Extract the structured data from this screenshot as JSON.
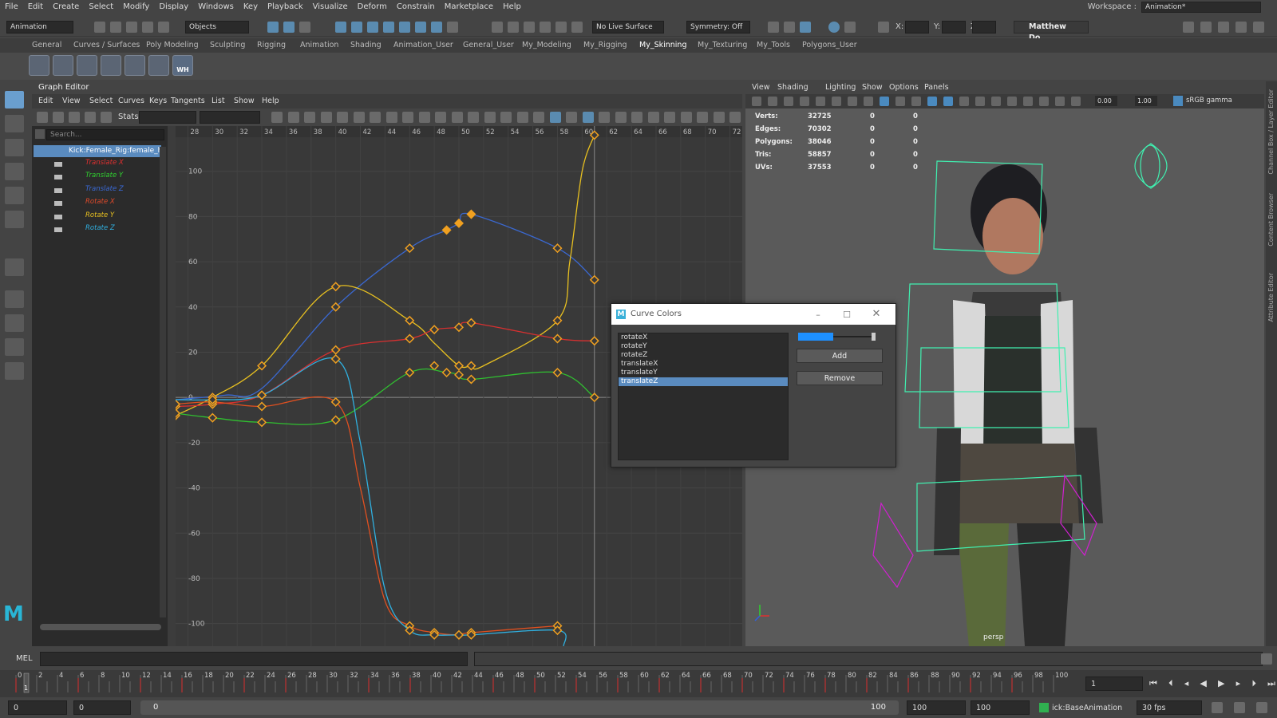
{
  "menubar": {
    "items": [
      "File",
      "Edit",
      "Create",
      "Select",
      "Modify",
      "Display",
      "Windows",
      "Key",
      "Playback",
      "Visualize",
      "Deform",
      "Constrain",
      "Marketplace",
      "Help"
    ],
    "workspace_label": "Workspace :",
    "workspace_value": "Animation*"
  },
  "statusline": {
    "mode": "Animation",
    "selection_mode": "Objects",
    "live_surface": "No Live Surface",
    "symmetry": "Symmetry: Off",
    "x_label": "X:",
    "y_label": "Y:",
    "z_label": "Z:",
    "user": "Matthew Do..."
  },
  "shelf": {
    "tabs": [
      "General",
      "Curves / Surfaces",
      "Poly Modeling",
      "Sculpting",
      "Rigging",
      "Animation",
      "Shading",
      "Animation_User",
      "General_User",
      "My_Modeling",
      "My_Rigging",
      "My_Skinning",
      "My_Texturing",
      "My_Tools",
      "Polygons_User"
    ],
    "active": "My_Skinning",
    "wh_label": "WH"
  },
  "graph_editor": {
    "title": "Graph Editor",
    "menu": [
      "Edit",
      "View",
      "Select",
      "Curves",
      "Keys",
      "Tangents",
      "List",
      "Show",
      "Help"
    ],
    "stats_label": "Stats",
    "search_placeholder": "Search...",
    "root": "Kick:Female_Rig:female_hip",
    "channels": [
      {
        "name": "Translate X",
        "color": "#e03030"
      },
      {
        "name": "Translate Y",
        "color": "#30d030"
      },
      {
        "name": "Translate Z",
        "color": "#3a6ad8"
      },
      {
        "name": "Rotate X",
        "color": "#e04a2a"
      },
      {
        "name": "Rotate Y",
        "color": "#e8c020"
      },
      {
        "name": "Rotate Z",
        "color": "#30b0e0"
      }
    ],
    "x_ticks": [
      "28",
      "30",
      "32",
      "34",
      "36",
      "38",
      "40",
      "42",
      "44",
      "46",
      "48",
      "50",
      "52",
      "54",
      "56",
      "58",
      "60",
      "62",
      "64",
      "66",
      "68",
      "70",
      "72"
    ],
    "y_ticks": [
      "100",
      "80",
      "60",
      "40",
      "20",
      "0",
      "-20",
      "-40",
      "-60",
      "-80",
      "-100"
    ],
    "current_frame_line": 61
  },
  "chart_data": {
    "type": "line",
    "xlim": [
      27,
      73
    ],
    "ylim": [
      -107,
      120
    ],
    "grid": true,
    "series": [
      {
        "name": "Translate Z",
        "color": "#3a68d0",
        "x": [
          27,
          31,
          34,
          40,
          46,
          49,
          50,
          51,
          58,
          61
        ],
        "y": [
          -1,
          1,
          4,
          40,
          66,
          74,
          77,
          81,
          66,
          52
        ],
        "keys": [
          [
            46,
            66
          ],
          [
            49,
            74
          ],
          [
            50,
            77
          ],
          [
            51,
            81
          ],
          [
            58,
            66
          ],
          [
            61,
            52
          ]
        ]
      },
      {
        "name": "Rotate Y",
        "color": "#e8c020",
        "x": [
          27,
          30,
          34,
          40,
          46,
          48,
          50,
          51,
          52,
          58,
          59,
          60,
          61
        ],
        "y": [
          -8,
          0,
          14,
          49,
          34,
          24,
          14,
          14,
          14,
          34,
          60,
          100,
          116
        ],
        "keys": [
          [
            27,
            -8
          ],
          [
            30,
            0
          ],
          [
            34,
            14
          ],
          [
            40,
            49
          ],
          [
            40,
            40
          ],
          [
            46,
            34
          ],
          [
            48,
            14
          ],
          [
            50,
            14
          ],
          [
            51,
            14
          ],
          [
            58,
            34
          ],
          [
            61,
            116
          ]
        ]
      },
      {
        "name": "Translate X",
        "color": "#d83030",
        "x": [
          27,
          30,
          34,
          40,
          46,
          48,
          50,
          51,
          58,
          61
        ],
        "y": [
          -4,
          -3,
          1,
          21,
          26,
          30,
          31,
          33,
          26,
          25
        ],
        "keys": [
          [
            27,
            -4
          ],
          [
            30,
            -3
          ],
          [
            34,
            1
          ],
          [
            40,
            21
          ],
          [
            46,
            26
          ],
          [
            48,
            30
          ],
          [
            50,
            31
          ],
          [
            51,
            33
          ],
          [
            58,
            26
          ],
          [
            61,
            25
          ]
        ]
      },
      {
        "name": "Translate Y",
        "color": "#30c030",
        "x": [
          27,
          30,
          34,
          40,
          46,
          49,
          50,
          51,
          58,
          61
        ],
        "y": [
          -7,
          -9,
          -11,
          -10,
          11,
          11,
          10,
          8,
          11,
          0
        ],
        "keys": [
          [
            27,
            -7
          ],
          [
            30,
            -9
          ],
          [
            34,
            -11
          ],
          [
            40,
            -10
          ],
          [
            46,
            11
          ],
          [
            49,
            11
          ],
          [
            50,
            10
          ],
          [
            51,
            8
          ],
          [
            58,
            11
          ],
          [
            61,
            0
          ]
        ]
      },
      {
        "name": "Rotate X",
        "color": "#e05020",
        "x": [
          27,
          30,
          34,
          40,
          42,
          44,
          46,
          48,
          50,
          51,
          58
        ],
        "y": [
          -3,
          -2,
          -4,
          -2,
          -40,
          -90,
          -101,
          -104,
          -105,
          -104,
          -101
        ],
        "keys": [
          [
            27,
            -3
          ],
          [
            30,
            -2
          ],
          [
            34,
            -4
          ],
          [
            40,
            -2
          ],
          [
            46,
            -101
          ],
          [
            48,
            -104
          ],
          [
            50,
            -105
          ],
          [
            51,
            -104
          ],
          [
            58,
            -101
          ]
        ]
      },
      {
        "name": "Rotate Z",
        "color": "#30b0e0",
        "x": [
          27,
          30,
          34,
          40,
          42,
          44,
          46,
          48,
          50,
          51,
          58,
          58.5
        ],
        "y": [
          -1,
          -1,
          1,
          17,
          -20,
          -85,
          -103,
          -105,
          -105,
          -105,
          -103,
          -110
        ],
        "keys": [
          [
            30,
            -1
          ],
          [
            34,
            1
          ],
          [
            40,
            17
          ],
          [
            46,
            -103
          ],
          [
            48,
            -105
          ],
          [
            50,
            -105
          ],
          [
            51,
            -105
          ],
          [
            58,
            -103
          ]
        ]
      }
    ]
  },
  "viewport": {
    "menu": [
      "View",
      "Shading",
      "Lighting",
      "Show",
      "Options",
      "Panels"
    ],
    "near": "0.00",
    "far": "1.00",
    "color_space": "sRGB gamma",
    "hud": [
      {
        "label": "Verts:",
        "value": "32725",
        "a": "0",
        "b": "0"
      },
      {
        "label": "Edges:",
        "value": "70302",
        "a": "0",
        "b": "0"
      },
      {
        "label": "Polygons:",
        "value": "38046",
        "a": "0",
        "b": "0"
      },
      {
        "label": "Tris:",
        "value": "58857",
        "a": "0",
        "b": "0"
      },
      {
        "label": "UVs:",
        "value": "37553",
        "a": "0",
        "b": "0"
      }
    ],
    "camera": "persp"
  },
  "right_strip": [
    "Channel Box / Layer Editor",
    "Content Browser",
    "Attribute Editor"
  ],
  "dialog": {
    "title": "Curve Colors",
    "items": [
      "rotateX",
      "rotateY",
      "rotateZ",
      "translateX",
      "translateY",
      "translateZ"
    ],
    "selected": "translateZ",
    "color": "#1e90ff",
    "add": "Add",
    "remove": "Remove"
  },
  "cmdline": {
    "label": "MEL"
  },
  "timeslider": {
    "ticks": [
      "0",
      "2",
      "4",
      "6",
      "8",
      "10",
      "12",
      "14",
      "16",
      "18",
      "20",
      "22",
      "24",
      "26",
      "28",
      "30",
      "32",
      "34",
      "36",
      "38",
      "40",
      "42",
      "44",
      "46",
      "48",
      "50",
      "52",
      "54",
      "56",
      "58",
      "60",
      "62",
      "64",
      "66",
      "68",
      "70",
      "72",
      "74",
      "76",
      "78",
      "80",
      "82",
      "84",
      "86",
      "88",
      "90",
      "92",
      "94",
      "96",
      "98",
      "100"
    ],
    "current": "1"
  },
  "range": {
    "start": "0",
    "start2": "0",
    "slider_start": "0",
    "slider_end": "100",
    "end": "100",
    "end2": "100",
    "anim_layer": "ick:BaseAnimation",
    "fps": "30 fps"
  }
}
